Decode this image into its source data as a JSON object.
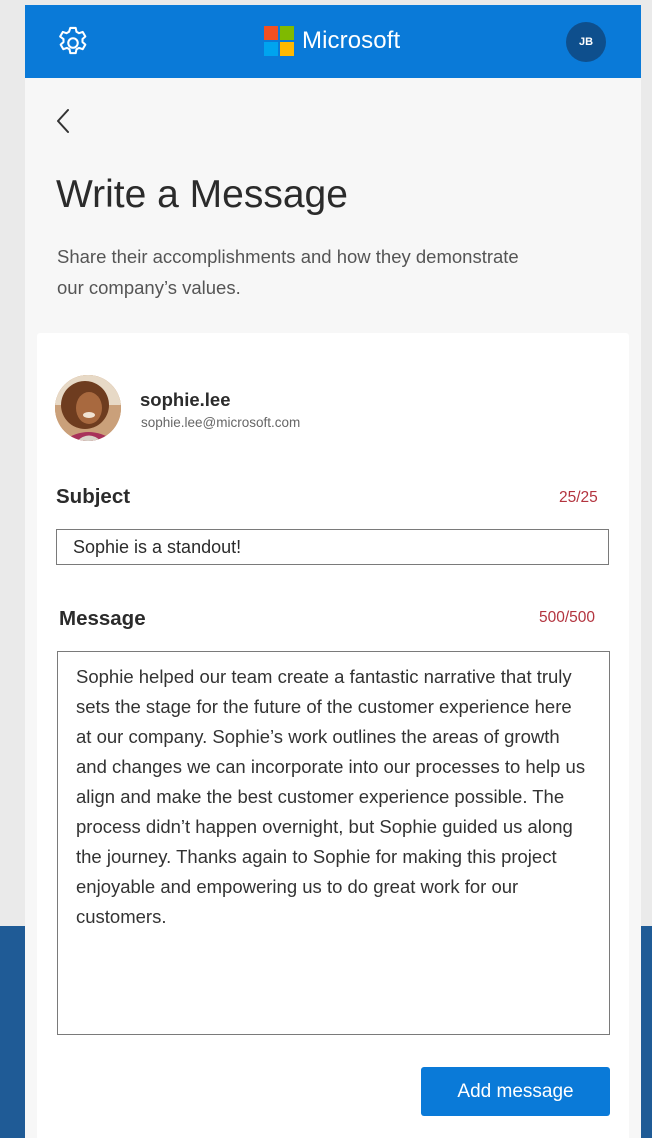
{
  "header": {
    "brand_name": "Microsoft",
    "user_initials": "JB",
    "settings_icon": "gear-icon",
    "logo_colors": [
      "#f25022",
      "#7fba00",
      "#00a4ef",
      "#ffb900"
    ]
  },
  "page": {
    "back_icon": "chevron-left-icon",
    "title": "Write a Message",
    "subtitle": "Share their accomplishments and how they demonstrate our company’s values."
  },
  "recipient": {
    "name": "sophie.lee",
    "email": "sophie.lee@microsoft.com"
  },
  "subject": {
    "label": "Subject",
    "counter": "25/25",
    "value": "Sophie is a standout!"
  },
  "message": {
    "label": "Message",
    "counter": "500/500",
    "value": "Sophie helped our team create a fantastic narrative that truly sets the stage for the future of the customer experience here at our company. Sophie’s work outlines the areas of growth and changes we can incorporate into our processes to help us align and make the best customer experience possible. The process didn’t happen overnight, but Sophie guided us along the journey. Thanks again to Sophie for making this project enjoyable and empowering us to do great work for our customers."
  },
  "actions": {
    "add_label": "Add message"
  },
  "colors": {
    "accent": "#0a7ad8",
    "counter": "#b3343f",
    "footer_band": "#1f5b96"
  }
}
